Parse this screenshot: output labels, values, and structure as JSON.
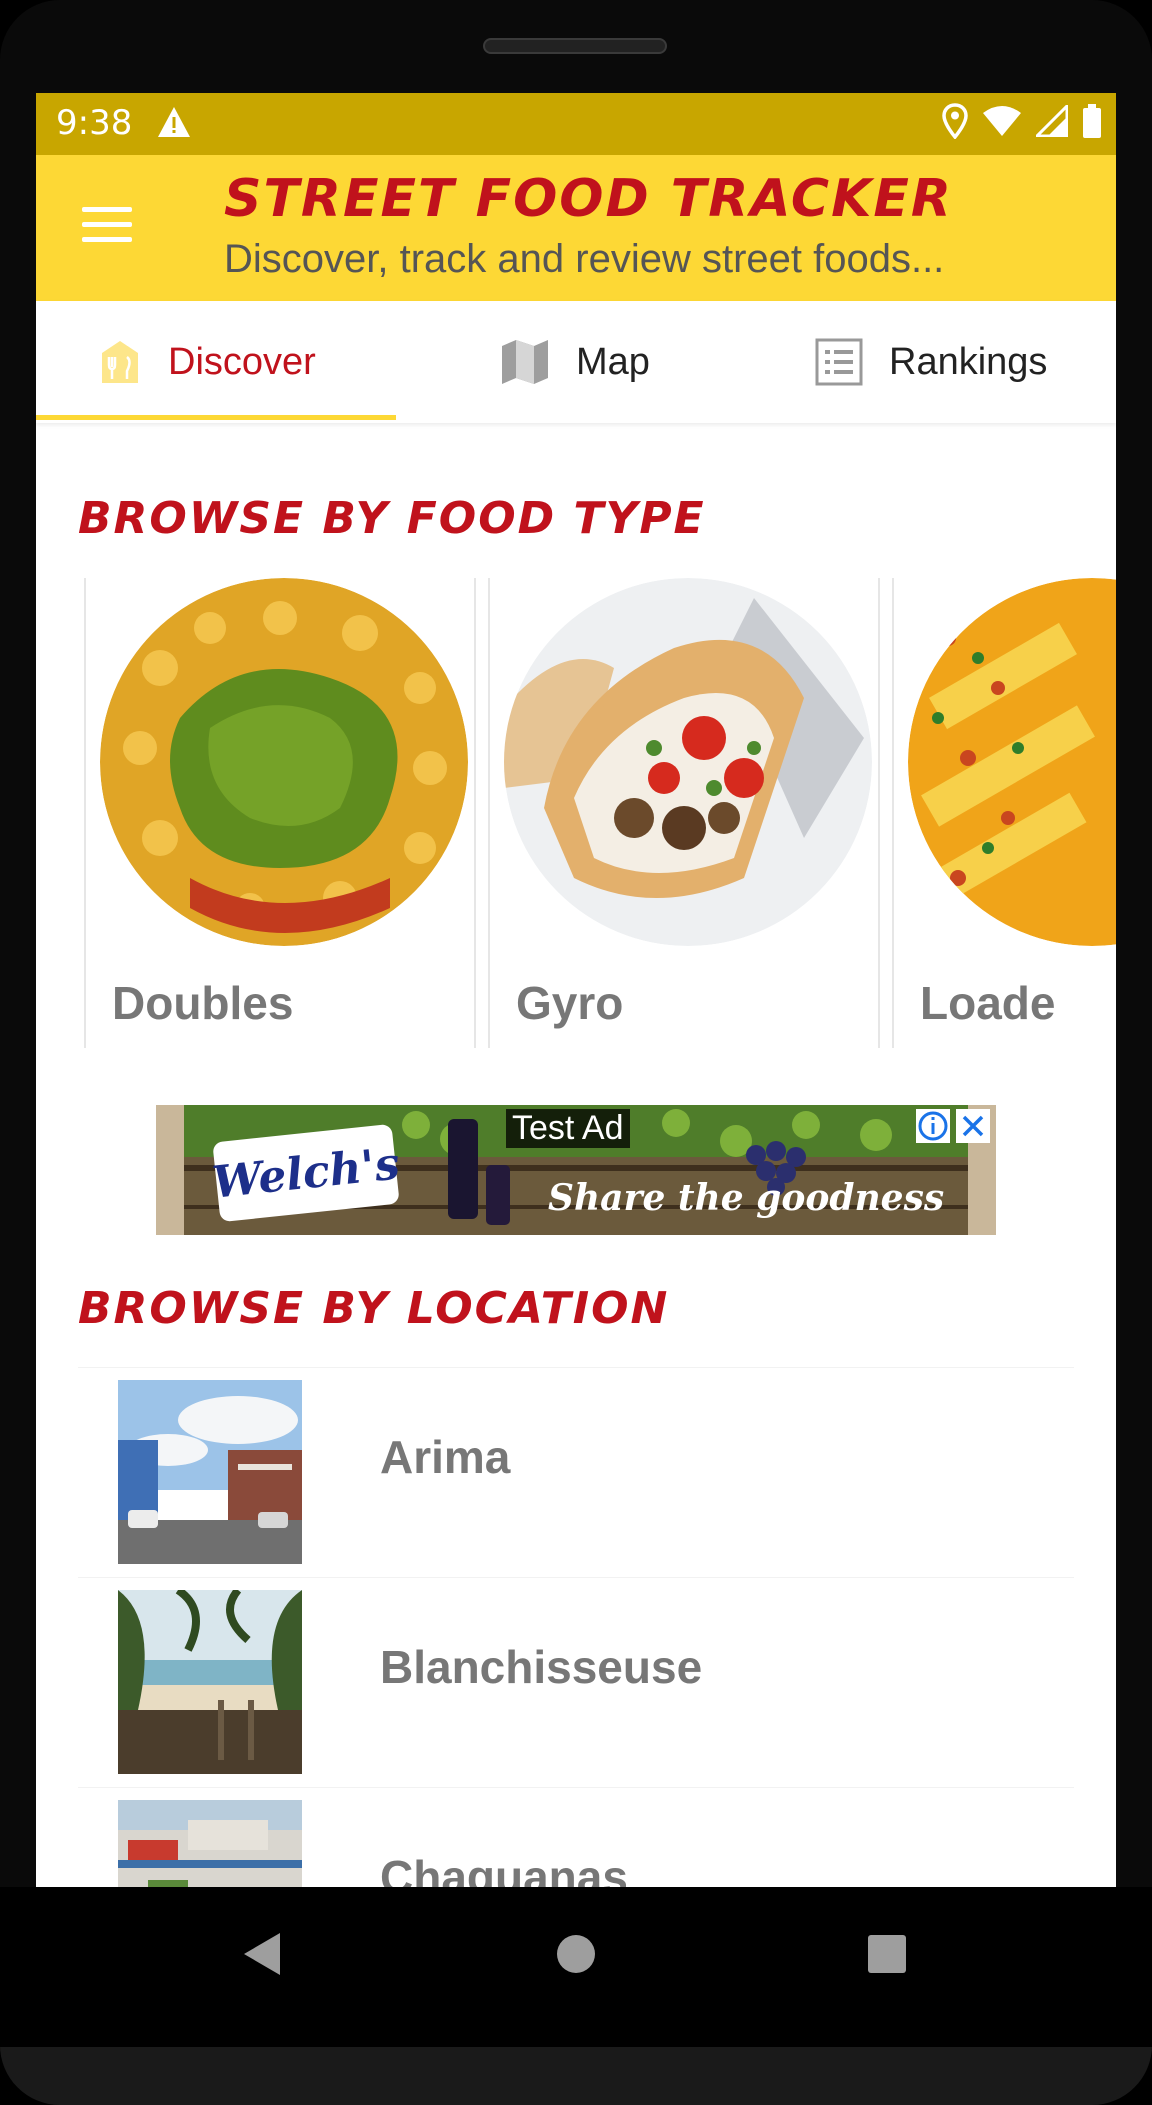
{
  "status_bar": {
    "time": "9:38",
    "icons": [
      "warning-icon",
      "location-icon",
      "wifi-icon",
      "signal-icon",
      "battery-icon"
    ]
  },
  "app_bar": {
    "title": "STREET FOOD TRACKER",
    "subtitle": "Discover, track and review street foods...",
    "menu_icon": "hamburger-menu-icon"
  },
  "tabs": [
    {
      "label": "Discover",
      "icon": "food-stall-icon",
      "active": true
    },
    {
      "label": "Map",
      "icon": "map-icon",
      "active": false
    },
    {
      "label": "Rankings",
      "icon": "list-icon",
      "active": false
    }
  ],
  "food_section": {
    "title": "BROWSE BY FOOD TYPE",
    "items": [
      {
        "label": "Doubles"
      },
      {
        "label": "Gyro"
      },
      {
        "label": "Loade"
      }
    ]
  },
  "ad": {
    "label": "Test Ad",
    "brand": "Welch's",
    "slogan": "Share the goodness"
  },
  "location_section": {
    "title": "BROWSE BY LOCATION",
    "items": [
      {
        "name": "Arima"
      },
      {
        "name": "Blanchisseuse"
      },
      {
        "name": "Chaguanas"
      }
    ]
  },
  "colors": {
    "status_bar": "#c8a600",
    "app_bar": "#fdd835",
    "accent_red": "#c0121c",
    "label_gray": "#777777"
  }
}
